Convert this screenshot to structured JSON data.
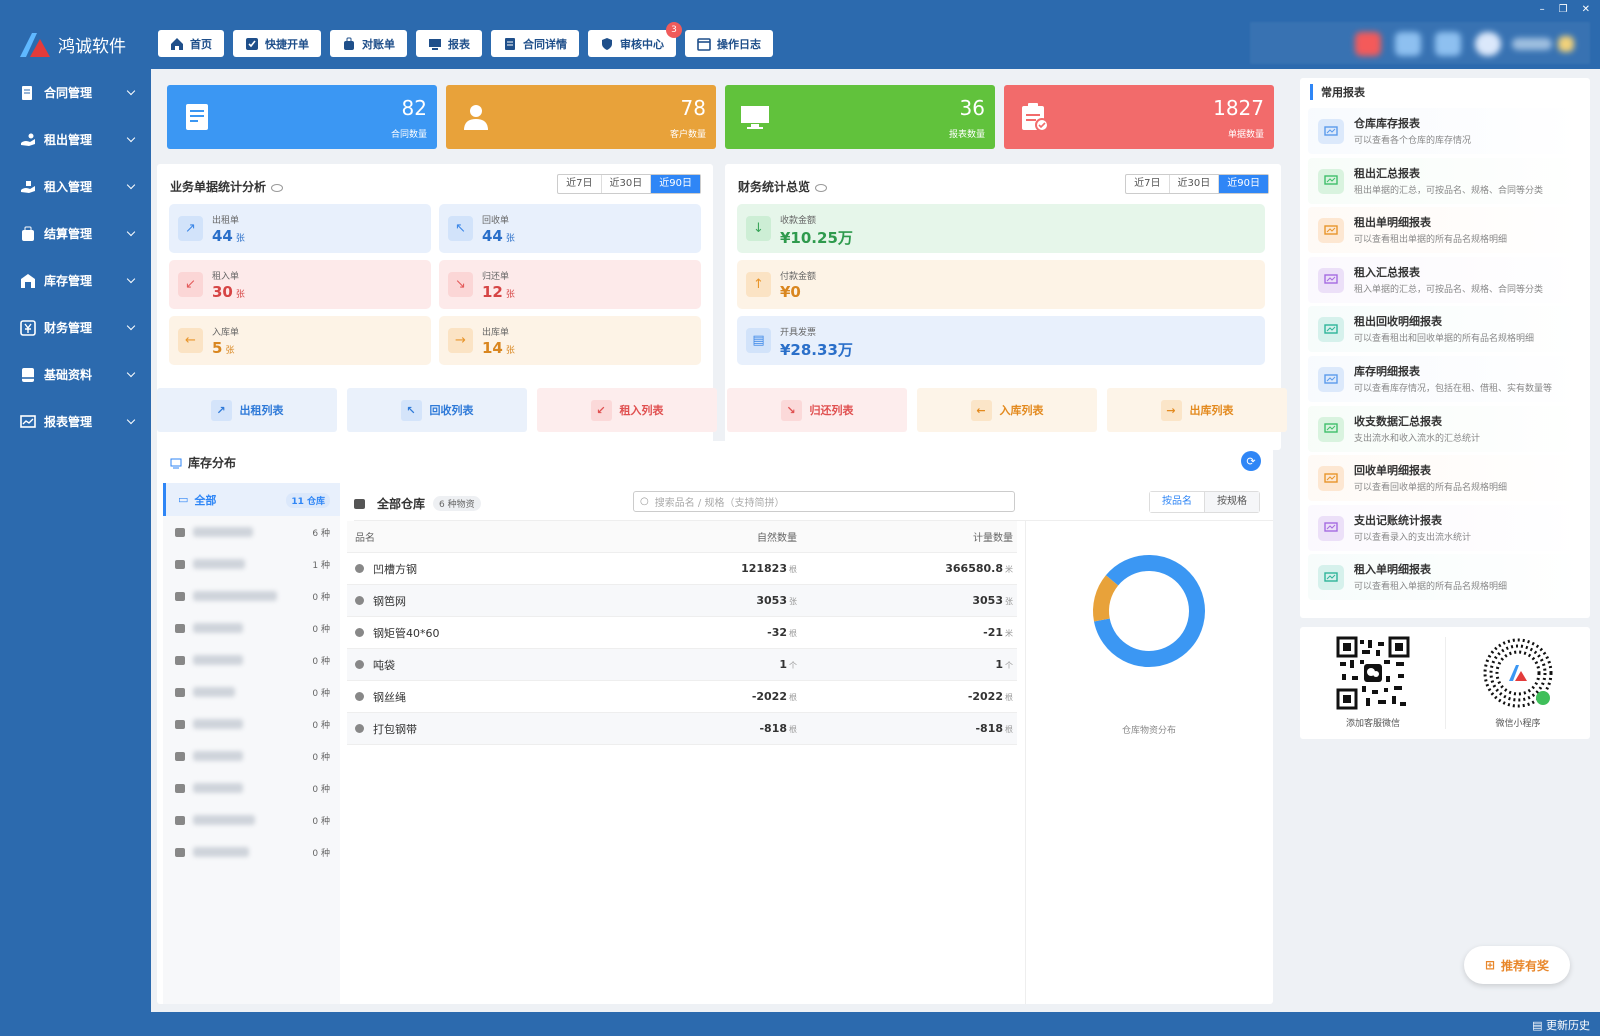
{
  "app": {
    "name": "鸿诚软件"
  },
  "nav": [
    {
      "label": "首页",
      "icon": "home-icon"
    },
    {
      "label": "快捷开单",
      "icon": "checklist-icon"
    },
    {
      "label": "对账单",
      "icon": "bag-icon"
    },
    {
      "label": "报表",
      "icon": "monitor-icon"
    },
    {
      "label": "合同详情",
      "icon": "document-icon"
    },
    {
      "label": "审核中心",
      "icon": "shield-icon",
      "badge": "3"
    },
    {
      "label": "操作日志",
      "icon": "calendar-icon"
    }
  ],
  "window": {
    "minimize": "–",
    "restore": "❐",
    "close": "✕"
  },
  "sidebar": [
    {
      "label": "合同管理",
      "icon": "contract-icon"
    },
    {
      "label": "租出管理",
      "icon": "rent-out-icon"
    },
    {
      "label": "租入管理",
      "icon": "rent-in-icon"
    },
    {
      "label": "结算管理",
      "icon": "settlement-icon"
    },
    {
      "label": "库存管理",
      "icon": "warehouse-icon"
    },
    {
      "label": "财务管理",
      "icon": "finance-icon"
    },
    {
      "label": "基础资料",
      "icon": "database-icon"
    },
    {
      "label": "报表管理",
      "icon": "chart-icon"
    }
  ],
  "cards": [
    {
      "num": "82",
      "label": "合同数量",
      "color": "#3b97f3"
    },
    {
      "num": "78",
      "label": "客户数量",
      "color": "#e8a23a"
    },
    {
      "num": "36",
      "label": "报表数量",
      "color": "#61c23c"
    },
    {
      "num": "1827",
      "label": "单据数量",
      "color": "#f26b6b"
    }
  ],
  "biz": {
    "title": "业务单据统计分析",
    "ranges": [
      "近7日",
      "近30日",
      "近90日"
    ],
    "items": [
      {
        "label": "出租单",
        "value": "44",
        "unit": "张",
        "arrow": "↗"
      },
      {
        "label": "回收单",
        "value": "44",
        "unit": "张",
        "arrow": "↖"
      },
      {
        "label": "租入单",
        "value": "30",
        "unit": "张",
        "arrow": "↙"
      },
      {
        "label": "归还单",
        "value": "12",
        "unit": "张",
        "arrow": "↘"
      },
      {
        "label": "入库单",
        "value": "5",
        "unit": "张",
        "arrow": "←"
      },
      {
        "label": "出库单",
        "value": "14",
        "unit": "张",
        "arrow": "→"
      }
    ]
  },
  "fin": {
    "title": "财务统计总览",
    "ranges": [
      "近7日",
      "近30日",
      "近90日"
    ],
    "items": [
      {
        "label": "收款金额",
        "value": "¥10.25万",
        "arrow": "↓"
      },
      {
        "label": "付款金额",
        "value": "¥0",
        "arrow": "↑"
      },
      {
        "label": "开具发票",
        "value": "¥28.33万",
        "arrow": "▤"
      }
    ]
  },
  "quick": [
    {
      "label": "出租列表",
      "arrow": "↗"
    },
    {
      "label": "回收列表",
      "arrow": "↖"
    },
    {
      "label": "租入列表",
      "arrow": "↙"
    },
    {
      "label": "归还列表",
      "arrow": "↘"
    },
    {
      "label": "入库列表",
      "arrow": "←"
    },
    {
      "label": "出库列表",
      "arrow": "→"
    }
  ],
  "inventory": {
    "title": "库存分布",
    "all_label": "全部",
    "all_count": "11 仓库",
    "warehouses": [
      "6 种",
      "1 种",
      "0 种",
      "0 种",
      "0 种",
      "0 种",
      "0 种",
      "0 种",
      "0 种",
      "0 种",
      "0 种"
    ],
    "current": "全部仓库",
    "current_count": "6 种物资",
    "search_placeholder": "搜索品名 / 规格（支持简拼）",
    "view_modes": [
      "按品名",
      "按规格"
    ],
    "columns": [
      "品名",
      "自然数量",
      "计量数量"
    ],
    "rows": [
      {
        "name": "凹槽方钢",
        "nat": "121823",
        "nat_unit": "根",
        "meas": "366580.8",
        "meas_unit": "米"
      },
      {
        "name": "钢笆网",
        "nat": "3053",
        "nat_unit": "张",
        "meas": "3053",
        "meas_unit": "张"
      },
      {
        "name": "钢矩管40*60",
        "nat": "-32",
        "nat_unit": "根",
        "meas": "-21",
        "meas_unit": "米"
      },
      {
        "name": "吨袋",
        "nat": "1",
        "nat_unit": "个",
        "meas": "1",
        "meas_unit": "个"
      },
      {
        "name": "钢丝绳",
        "nat": "-2022",
        "nat_unit": "根",
        "meas": "-2022",
        "meas_unit": "根"
      },
      {
        "name": "打包钢带",
        "nat": "-818",
        "nat_unit": "根",
        "meas": "-818",
        "meas_unit": "根"
      }
    ],
    "donut_label": "仓库物资分布"
  },
  "chart_data": {
    "type": "pie",
    "title": "仓库物资分布",
    "categories": [
      "",
      ""
    ],
    "values": [
      86,
      14
    ],
    "colors": [
      "#3b97f3",
      "#e8a23a"
    ]
  },
  "reports": {
    "title": "常用报表",
    "items": [
      {
        "title": "仓库库存报表",
        "desc": "可以查看各个仓库的库存情况",
        "color": "#dce9fb"
      },
      {
        "title": "租出汇总报表",
        "desc": "租出单据的汇总，可按品名、规格、合同等分类",
        "color": "#d9f3df"
      },
      {
        "title": "租出单明细报表",
        "desc": "可以查看租出单据的所有品名规格明细",
        "color": "#fde7d2"
      },
      {
        "title": "租入汇总报表",
        "desc": "租入单据的汇总，可按品名、规格、合同等分类",
        "color": "#ece0f8"
      },
      {
        "title": "租出回收明细报表",
        "desc": "可以查看租出和回收单据的所有品名规格明细",
        "color": "#d6f1ec"
      },
      {
        "title": "库存明细报表",
        "desc": "可以查看库存情况，包括在租、借租、实有数量等",
        "color": "#dce9fb"
      },
      {
        "title": "收支数据汇总报表",
        "desc": "支出流水和收入流水的汇总统计",
        "color": "#d9f3df"
      },
      {
        "title": "回收单明细报表",
        "desc": "可以查看回收单据的所有品名规格明细",
        "color": "#fde7d2"
      },
      {
        "title": "支出记账统计报表",
        "desc": "可以查看录入的支出流水统计",
        "color": "#ece0f8"
      },
      {
        "title": "租入单明细报表",
        "desc": "可以查看租入单据的所有品名规格明细",
        "color": "#d6f1ec"
      }
    ]
  },
  "qr": [
    {
      "label": "添加客服微信"
    },
    {
      "label": "微信小程序"
    }
  ],
  "reward": "推荐有奖",
  "history": "更新历史"
}
